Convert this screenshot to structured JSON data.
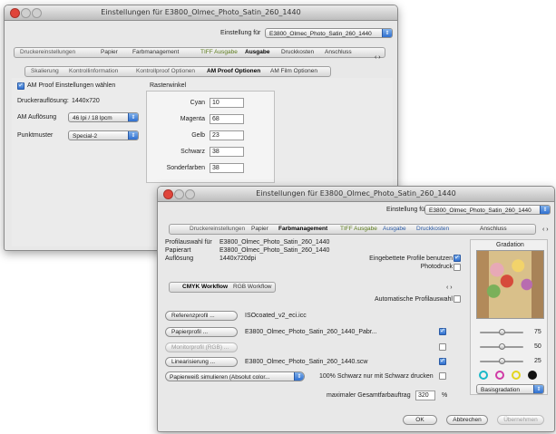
{
  "win1": {
    "title": "Einstellungen für E3800_Olmec_Photo_Satin_260_1440",
    "einstellung_label": "Einstellung für",
    "einstellung_value": "E3800_Olmec_Photo_Satin_260_1440",
    "tabs_top": [
      "Druckereinstellungen",
      "Papier",
      "Farbmanagement",
      "TIFF Ausgabe",
      "Ausgabe",
      "Druckkosten",
      "Anschluss"
    ],
    "tabs_sub": [
      "Skalierung",
      "Kontrollinformation",
      "Kontrollproof Optionen",
      "AM Proof Optionen",
      "AM Film Optionen"
    ],
    "am_proof_label": "AM Proof Einstellungen wählen",
    "aufloesung_label": "Druckerauflösung:",
    "aufloesung_value": "1440x720",
    "am_aufl_label": "AM Auflösung",
    "am_aufl_value": "46 lpi / 18 lpcm",
    "punktmuster_label": "Punktmuster",
    "punktmuster_value": "Special-2",
    "rasterwinkel_title": "Rasterwinkel",
    "angles": [
      {
        "label": "Cyan",
        "value": "10"
      },
      {
        "label": "Magenta",
        "value": "68"
      },
      {
        "label": "Gelb",
        "value": "23"
      },
      {
        "label": "Schwarz",
        "value": "38"
      },
      {
        "label": "Sonderfarben",
        "value": "38"
      }
    ]
  },
  "win2": {
    "title": "Einstellungen für E3800_Olmec_Photo_Satin_260_1440",
    "einstellung_label": "Einstellung für",
    "einstellung_value": "E3800_Olmec_Photo_Satin_260_1440",
    "tabs_top": [
      "Druckereinstellungen",
      "Papier",
      "Farbmanagement",
      "TIFF Ausgabe",
      "Ausgabe",
      "Druckkosten",
      "Anschluss"
    ],
    "info": [
      {
        "label": "Profilauswahl für",
        "value": "E3800_Olmec_Photo_Satin_260_1440"
      },
      {
        "label": "Papierart",
        "value": "E3800_Olmec_Photo_Satin_260_1440"
      },
      {
        "label": "Auflösung",
        "value": "1440x720dpi"
      }
    ],
    "eingebettete_label": "Eingebettete Profile benutzen",
    "photodruck_label": "Photodruck",
    "workflow_tabs": [
      "CMYK Workflow",
      "RGB Workflow"
    ],
    "auto_profil_label": "Automatische Profilauswahl",
    "profile_rows": [
      {
        "button": "Referenzprofil ...",
        "value": "ISOcoated_v2_eci.icc",
        "checked": false,
        "has_check": false,
        "disabled": false
      },
      {
        "button": "Papierprofil ...",
        "value": "E3800_Olmec_Photo_Satin_260_1440_Pabr...",
        "checked": true,
        "has_check": true,
        "disabled": false
      },
      {
        "button": "Monitorprofil (RGB) ...",
        "value": "",
        "checked": false,
        "has_check": true,
        "disabled": true
      },
      {
        "button": "Linearisierung ...",
        "value": "E3800_Olmec_Photo_Satin_260_1440.scw",
        "checked": true,
        "has_check": true,
        "disabled": false
      }
    ],
    "papierweiss_value": "Papierweiß simulieren (Absolut color...",
    "schwarz_label": "100% Schwarz nur mit Schwarz drucken",
    "gesamtfarbauftrag_label": "maximaler Gesamtfarbauftrag",
    "gesamtfarbauftrag_value": "320",
    "gesamtfarbauftrag_unit": "%",
    "gradation_title": "Gradation",
    "slider_values": [
      "75",
      "50",
      "25"
    ],
    "color_dot_colors": [
      "#19b8c8",
      "#d03aa6",
      "#e3d51e",
      "#111111"
    ],
    "basisgradation_value": "Basisgradation",
    "buttons": {
      "ok": "OK",
      "abbrechen": "Abbrechen",
      "uebernehmen": "Übernehmen"
    },
    "nav_arrows": "‹ ›"
  }
}
